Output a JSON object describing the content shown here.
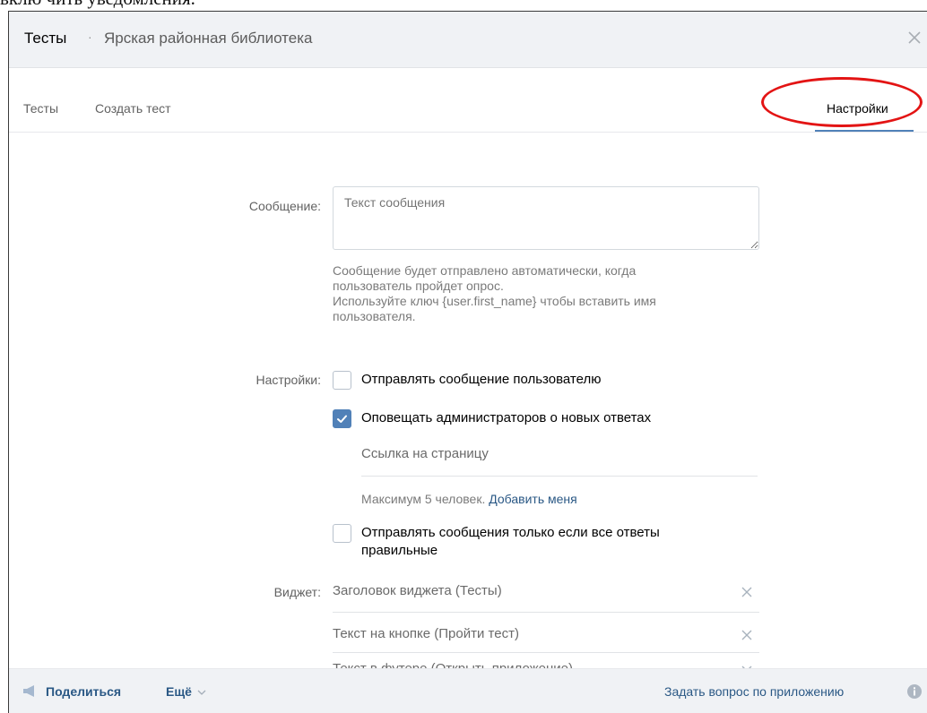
{
  "background_text": "вклю чить уведомления.",
  "modal": {
    "title": "Тесты",
    "separator": "·",
    "subtitle": "Ярская районная библиотека",
    "close_icon": "close-icon"
  },
  "tabs": [
    {
      "label": "Тесты",
      "active": false
    },
    {
      "label": "Создать тест",
      "active": false
    },
    {
      "label": "Настройки",
      "active": true
    }
  ],
  "form": {
    "message_label": "Сообщение:",
    "message_value": "",
    "message_placeholder": "Текст сообщения",
    "hint_lines": [
      "Сообщение будет отправлено автоматически, когда",
      "пользователь пройдет опрос.",
      "Используйте ключ {user.first_name} чтобы вставить имя",
      "пользователя."
    ],
    "settings_label": "Настройки:",
    "send_to_user": {
      "label": "Отправлять сообщение пользователю",
      "checked": false
    },
    "notify_admins": {
      "label": "Оповещать администраторов о новых ответах",
      "checked": true
    },
    "page_link_placeholder": "Ссылка на страницу",
    "max_people_text": "Максимум 5 человек.",
    "add_me_link": "Добавить меня",
    "only_if_correct": {
      "label_line1": "Отправлять сообщения только если все ответы",
      "label_line2": "правильные",
      "checked": false
    },
    "widget_label": "Виджет:",
    "widget_title_placeholder": "Заголовок виджета (Тесты)",
    "button_text_placeholder": "Текст на кнопке (Пройти тест)",
    "footer_text_placeholder": "Текст в футере (Открыть приложение)"
  },
  "footer": {
    "share_label": "Поделиться",
    "more_label": "Ещё",
    "ask_label": "Задать вопрос по приложению"
  },
  "colors": {
    "accent": "#5181b8",
    "link": "#2a5885",
    "annotation": "#e31414"
  }
}
